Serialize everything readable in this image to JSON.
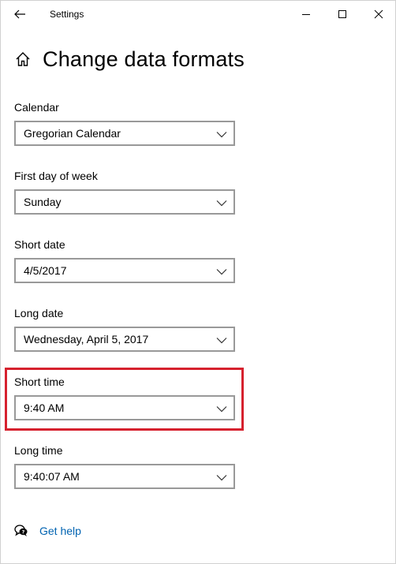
{
  "window": {
    "title": "Settings"
  },
  "page": {
    "title": "Change data formats"
  },
  "fields": [
    {
      "label": "Calendar",
      "value": "Gregorian Calendar"
    },
    {
      "label": "First day of week",
      "value": "Sunday"
    },
    {
      "label": "Short date",
      "value": "4/5/2017"
    },
    {
      "label": "Long date",
      "value": "Wednesday, April 5, 2017"
    },
    {
      "label": "Short time",
      "value": "9:40 AM"
    },
    {
      "label": "Long time",
      "value": "9:40:07 AM"
    }
  ],
  "help": {
    "link_label": "Get help"
  },
  "colors": {
    "highlight": "#d6212e",
    "link": "#0063b1",
    "dropdown_border": "#999999"
  },
  "icons": {
    "back": "back-arrow-icon",
    "minimize": "minimize-icon",
    "maximize": "maximize-icon",
    "close": "close-icon",
    "home": "home-icon",
    "chevron": "chevron-down-icon",
    "help": "help-chat-icon"
  }
}
